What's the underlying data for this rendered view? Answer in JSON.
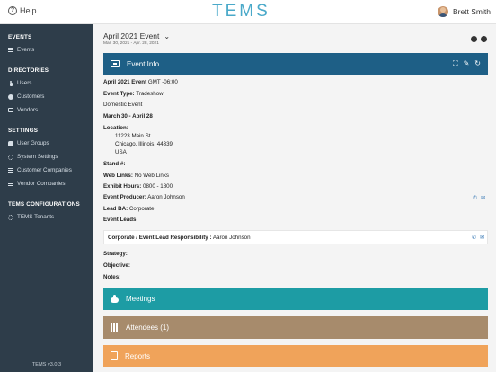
{
  "header": {
    "help_label": "Help",
    "logo_text": "TEMS",
    "user_name": "Brett Smith"
  },
  "sidebar": {
    "sections": [
      {
        "title": "EVENTS",
        "items": [
          "Events"
        ]
      },
      {
        "title": "DIRECTORIES",
        "items": [
          "Users",
          "Customers",
          "Vendors"
        ]
      },
      {
        "title": "SETTINGS",
        "items": [
          "User Groups",
          "System Settings",
          "Customer Companies",
          "Vendor Companies"
        ]
      },
      {
        "title": "TEMS CONFIGURATIONS",
        "items": [
          "TEMS Tenants"
        ]
      }
    ],
    "version": "TEMS v3.0.3"
  },
  "page": {
    "title": "April 2021 Event",
    "subtitle": "Mar. 30, 2021 - Apr. 28, 2021"
  },
  "event_info": {
    "panel_title": "Event Info",
    "name": "April 2021 Event",
    "timezone": "GMT -06:00",
    "type_label": "Event Type:",
    "type_value": "Tradeshow",
    "scope": "Domestic Event",
    "dates": "March 30 - April 28",
    "location_label": "Location:",
    "address_line1": "11223 Main St.",
    "address_line2": "Chicago, Illinois, 44339",
    "address_line3": "USA",
    "stand_label": "Stand #:",
    "weblinks_label": "Web Links:",
    "weblinks_value": "No Web Links",
    "hours_label": "Exhibit Hours:",
    "hours_value": "0800 - 1800",
    "producer_label": "Event Producer:",
    "producer_value": "Aaron Johnson",
    "leadba_label": "Lead BA:",
    "leadba_value": "Corporate",
    "leads_label": "Event Leads:",
    "lead_card_label": "Corporate / Event Lead Responsibility :",
    "lead_card_value": "Aaron Johnson",
    "strategy_label": "Strategy:",
    "objective_label": "Objective:",
    "notes_label": "Notes:"
  },
  "sections": {
    "meetings": "Meetings",
    "attendees": "Attendees (1)",
    "reports": "Reports"
  },
  "colors": {
    "sidebar_bg": "#2e3d4a",
    "event_info_header": "#1e5f86",
    "meetings": "#1d9ca4",
    "attendees": "#a78b6c",
    "reports": "#f0a35a",
    "logo": "#4aa9c9"
  }
}
